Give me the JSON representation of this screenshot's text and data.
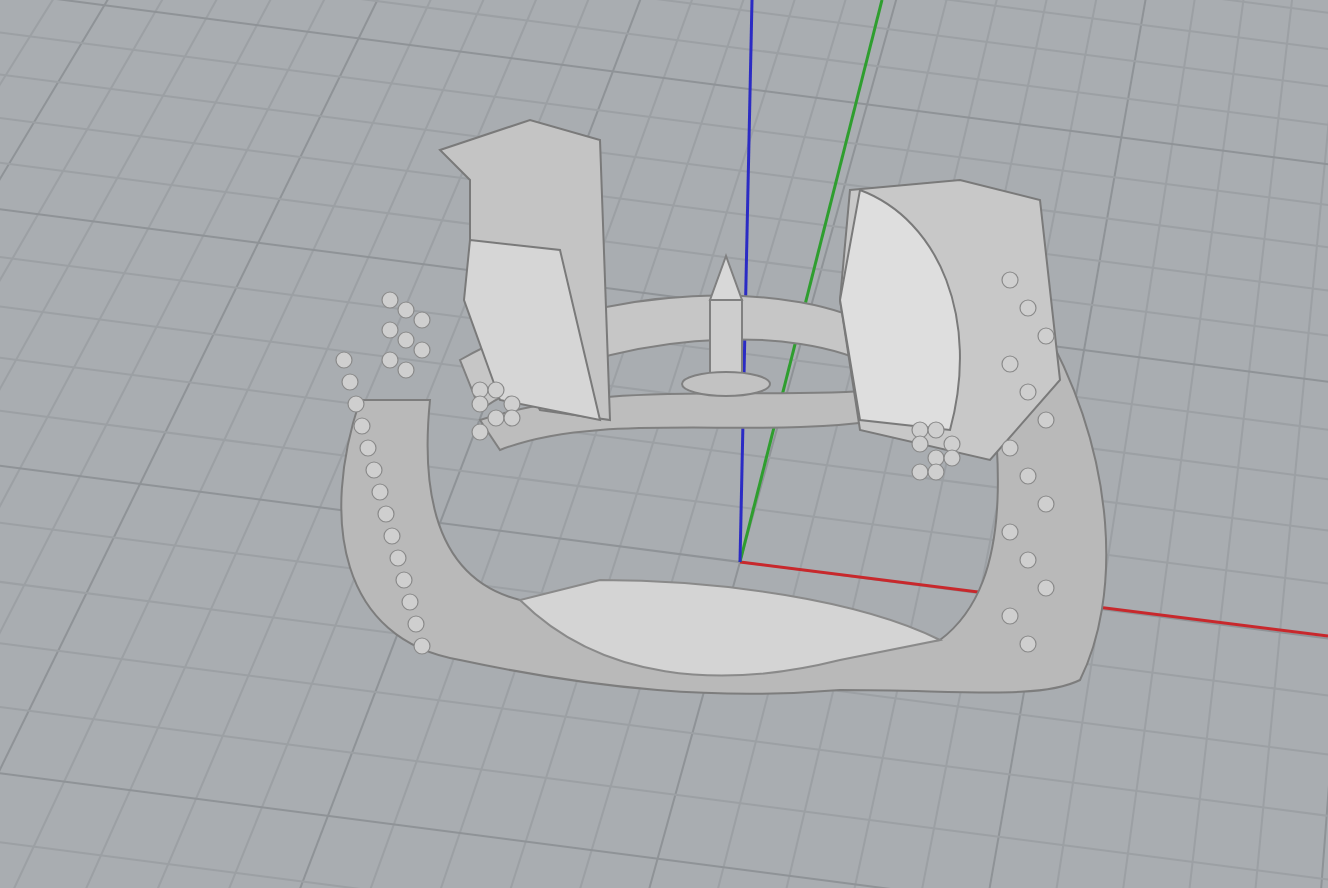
{
  "viewport": {
    "axes": [
      {
        "kind": "x",
        "color": "#c8282c"
      },
      {
        "kind": "y",
        "color": "#2f9e2f"
      },
      {
        "kind": "z",
        "color": "#2b2bc4"
      }
    ]
  }
}
